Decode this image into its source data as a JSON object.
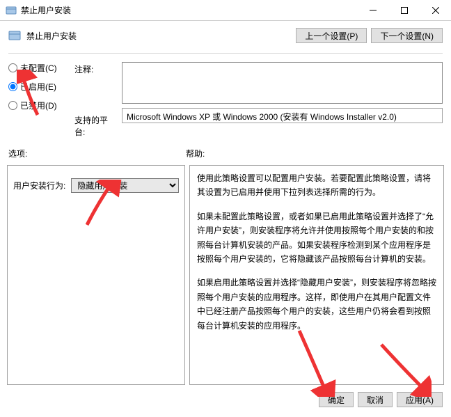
{
  "window": {
    "title": "禁止用户安装"
  },
  "header": {
    "title": "禁止用户安装",
    "prev_btn": "上一个设置(P)",
    "next_btn": "下一个设置(N)"
  },
  "radios": {
    "not_configured": "未配置(C)",
    "enabled": "已启用(E)",
    "disabled": "已禁用(D)"
  },
  "labels": {
    "comment": "注释:",
    "platform": "支持的平台:",
    "options": "选项:",
    "help": "帮助:"
  },
  "fields": {
    "platform_value": "Microsoft Windows XP 或 Windows 2000 (安装有 Windows Installer v2.0)"
  },
  "options": {
    "behavior_label": "用户安装行为:",
    "behavior_value": "隐藏用户安装"
  },
  "help": {
    "p1": "使用此策略设置可以配置用户安装。若要配置此策略设置，请将其设置为已启用并使用下拉列表选择所需的行为。",
    "p2": "如果未配置此策略设置，或者如果已启用此策略设置并选择了“允许用户安装”，则安装程序将允许并使用按照每个用户安装的和按照每台计算机安装的产品。如果安装程序检测到某个应用程序是按照每个用户安装的，它将隐藏该产品按照每台计算机的安装。",
    "p3": "如果启用此策略设置并选择“隐藏用户安装”，则安装程序将忽略按照每个用户安装的应用程序。这样，即使用户在其用户配置文件中已经注册产品按照每个用户的安装，这些用户仍将会看到按照每台计算机安装的应用程序。"
  },
  "footer": {
    "ok": "确定",
    "cancel": "取消",
    "apply": "应用(A)"
  },
  "colors": {
    "arrow": "#ee3233"
  }
}
